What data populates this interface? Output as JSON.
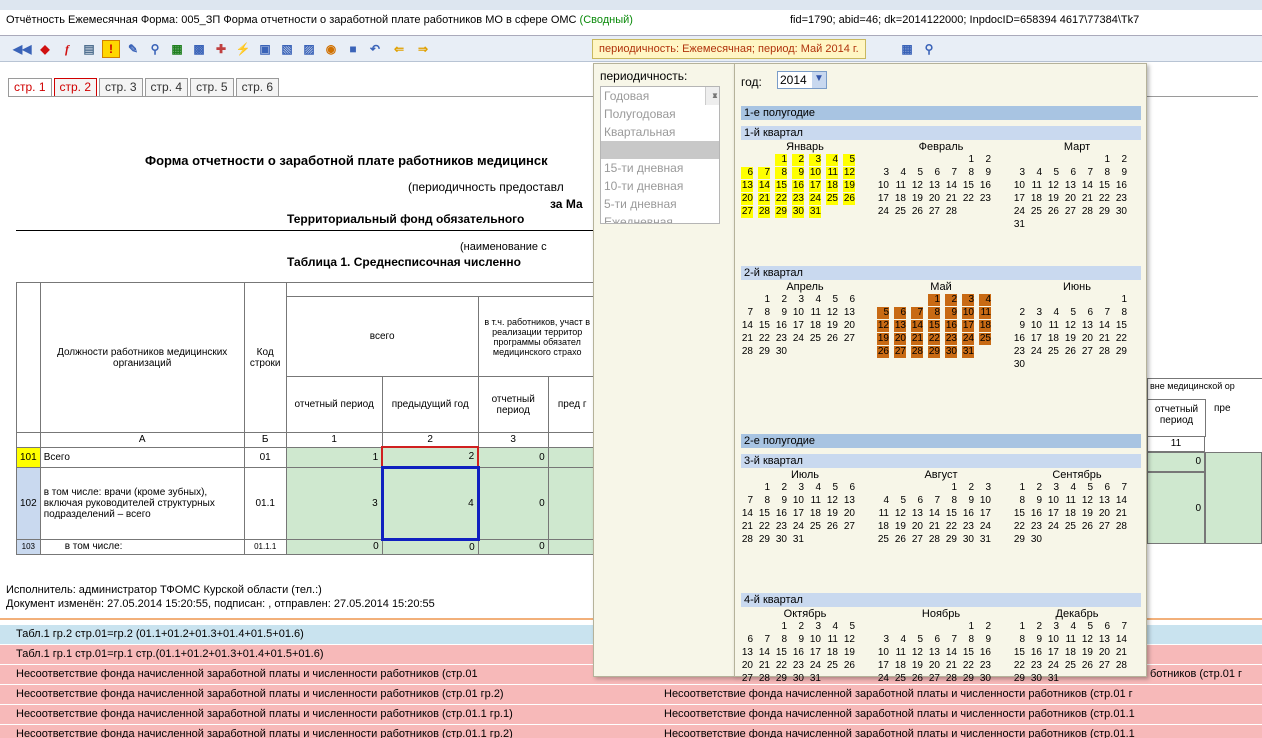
{
  "title": {
    "prefix": "Отчётность Ежемесячная Форма: 005_ЗП Форма отчетности о заработной плате работников МО в сфере ОМС ",
    "green": "(Сводный)",
    "ids": "fid=1790; abid=46; dk=2014122000; InpdocID=658394 4617\\77384\\Tk7"
  },
  "toolbar": {
    "period_label": "периодичность: Ежемесячная; период: Май 2014 г."
  },
  "tabs": [
    "стр. 1",
    "стр. 2",
    "стр. 3",
    "стр. 4",
    "стр. 5",
    "стр. 6"
  ],
  "form": {
    "title": "Форма отчетности о заработной плате работников медицинск",
    "sub1": "(периодичность предоставл",
    "sub2": "за Ма",
    "sub3": "Территориальный фонд обязательного",
    "sub4": "(наименование с",
    "sub5": "Таблица 1. Среднесписочная численно"
  },
  "table": {
    "col_positions": "Должности работников медицинских организаций",
    "col_code": "Код строки",
    "col_total": "всего",
    "col_terr": "в т.ч. работников, участ в реализации территор программы обязател медицинского страхо",
    "col_report": "отчетный период",
    "col_prev": "предыдущий год",
    "col_report2": "отчетный период",
    "col_prev2": "пред г",
    "col_outside": "вне медицинской ор",
    "col_report3": "отчетный период",
    "col_prev3": "пре",
    "letters": [
      "А",
      "Б",
      "1",
      "2",
      "3",
      "11"
    ],
    "rows": [
      {
        "num": "101",
        "name": "Всего",
        "code": "01",
        "v1": "1",
        "v2": "2",
        "v3": "0",
        "v11": "0"
      },
      {
        "num": "102",
        "name": "в том числе: врачи (кроме зубных), включая руководителей структурных подразделений – всего",
        "code": "01.1",
        "v1": "3",
        "v2": "4",
        "v3": "0",
        "v11": "0"
      },
      {
        "num": "103",
        "name": "в том числе:",
        "code": "01.1.1",
        "v1": "0",
        "v2": "0",
        "v3": "0",
        "v11": ""
      }
    ]
  },
  "footer": {
    "line1": "Исполнитель: администратор ТФОМС Курской области (тел.:)",
    "line2": "Документ изменён: 27.05.2014 15:20:55, подписан: , отправлен: 27.05.2014 15:20:55"
  },
  "errors": [
    {
      "text": "Табл.1 гр.2 стр.01=гр.2 (01.1+01.2+01.3+01.4+01.5+01.6)",
      "text2": "",
      "color": "blue"
    },
    {
      "text": "Табл.1 гр.1 стр.01=гр.1 стр.(01.1+01.2+01.3+01.4+01.5+01.6)",
      "text2": "",
      "color": "pink"
    },
    {
      "text": "Несоответствие фонда начисленной заработной платы и численности работников (стр.01",
      "text2": "ботников (стр.01 г",
      "color": "pink"
    },
    {
      "text": "Несоответствие фонда начисленной заработной платы и численности работников (стр.01 гр.2)",
      "text2": "Несоответствие фонда начисленной заработной платы и численности работников (стр.01 г",
      "color": "pink"
    },
    {
      "text": "Несоответствие фонда начисленной заработной платы и численности работников (стр.01.1 гр.1)",
      "text2": "Несоответствие фонда начисленной заработной платы и численности работников (стр.01.1",
      "color": "pink"
    },
    {
      "text": "Несоответствие фонда начисленной заработной платы и численности работников (стр.01.1 гр.2)",
      "text2": "Несоответствие фонда начисленной заработной платы и численности работников (стр.01.1",
      "color": "pink"
    }
  ],
  "periodicity": {
    "label": "периодичность:",
    "options": [
      "Годовая",
      "Полугодовая",
      "Квартальная",
      "",
      "15-ти дневная",
      "10-ти дневная",
      "5-ти дневная",
      "Ежедневная"
    ],
    "selected_index": 3
  },
  "calendar": {
    "year_label": "год:",
    "year": "2014",
    "halves": [
      "1-е полугодие",
      "2-е полугодие"
    ],
    "quarters": [
      "1-й квартал",
      "2-й квартал",
      "3-й квартал",
      "4-й квартал"
    ],
    "months": [
      {
        "name": "Январь",
        "start": 2,
        "days": 31,
        "hl": "yellow"
      },
      {
        "name": "Февраль",
        "start": 5,
        "days": 28,
        "hl": ""
      },
      {
        "name": "Март",
        "start": 5,
        "days": 31,
        "hl": ""
      },
      {
        "name": "Апрель",
        "start": 1,
        "days": 30,
        "hl": ""
      },
      {
        "name": "Май",
        "start": 3,
        "days": 31,
        "hl": "brown"
      },
      {
        "name": "Июнь",
        "start": 6,
        "days": 30,
        "hl": ""
      },
      {
        "name": "Июль",
        "start": 1,
        "days": 31,
        "hl": ""
      },
      {
        "name": "Август",
        "start": 4,
        "days": 31,
        "hl": ""
      },
      {
        "name": "Сентябрь",
        "start": 0,
        "days": 30,
        "hl": ""
      },
      {
        "name": "Октябрь",
        "start": 2,
        "days": 31,
        "hl": ""
      },
      {
        "name": "Ноябрь",
        "start": 5,
        "days": 30,
        "hl": ""
      },
      {
        "name": "Декабрь",
        "start": 0,
        "days": 31,
        "hl": ""
      }
    ]
  },
  "colors": {
    "accent": "#c86a14",
    "highlight": "#ffff00",
    "error": "#f7b9b9",
    "info": "#c9e3ef"
  }
}
